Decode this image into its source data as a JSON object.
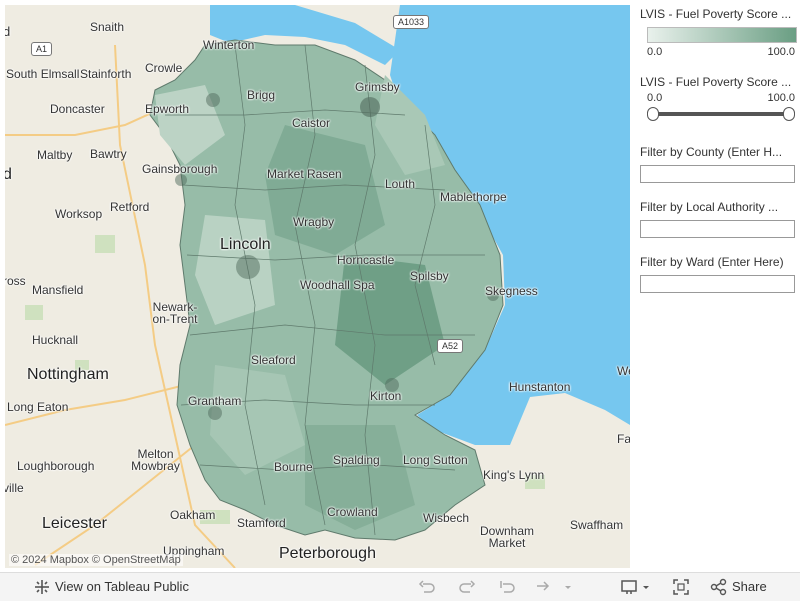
{
  "map": {
    "towns": [
      {
        "id": "snaith",
        "name": "Snaith"
      },
      {
        "id": "crowle",
        "name": "Crowle"
      },
      {
        "id": "winterton",
        "name": "Winterton"
      },
      {
        "id": "grimsby",
        "name": "Grimsby"
      },
      {
        "id": "south-elmsall",
        "name": "South Elmsall"
      },
      {
        "id": "stainforth",
        "name": "Stainforth"
      },
      {
        "id": "epworth",
        "name": "Epworth"
      },
      {
        "id": "brigg",
        "name": "Brigg"
      },
      {
        "id": "doncaster",
        "name": "Doncaster"
      },
      {
        "id": "caistor",
        "name": "Caistor"
      },
      {
        "id": "maltby",
        "name": "Maltby"
      },
      {
        "id": "bawtry",
        "name": "Bawtry"
      },
      {
        "id": "gainsborough",
        "name": "Gainsborough"
      },
      {
        "id": "market-rasen",
        "name": "Market Rasen"
      },
      {
        "id": "louth",
        "name": "Louth"
      },
      {
        "id": "mablethorpe",
        "name": "Mablethorpe"
      },
      {
        "id": "worksop",
        "name": "Worksop"
      },
      {
        "id": "retford",
        "name": "Retford"
      },
      {
        "id": "wragby",
        "name": "Wragby"
      },
      {
        "id": "lincoln",
        "name": "Lincoln"
      },
      {
        "id": "horncastle",
        "name": "Horncastle"
      },
      {
        "id": "spilsby",
        "name": "Spilsby"
      },
      {
        "id": "mansfield",
        "name": "Mansfield"
      },
      {
        "id": "woodhall-spa",
        "name": "Woodhall Spa"
      },
      {
        "id": "skegness",
        "name": "Skegness"
      },
      {
        "id": "newark",
        "name": "Newark-on-Trent"
      },
      {
        "id": "hucknall",
        "name": "Hucknall"
      },
      {
        "id": "sleaford",
        "name": "Sleaford"
      },
      {
        "id": "nottingham",
        "name": "Nottingham"
      },
      {
        "id": "hunstanton",
        "name": "Hunstanton"
      },
      {
        "id": "long-eaton",
        "name": "Long Eaton"
      },
      {
        "id": "grantham",
        "name": "Grantham"
      },
      {
        "id": "kirton",
        "name": "Kirton"
      },
      {
        "id": "melton",
        "name": "Melton Mowbray"
      },
      {
        "id": "loughborough",
        "name": "Loughborough"
      },
      {
        "id": "spalding",
        "name": "Spalding"
      },
      {
        "id": "long-sutton",
        "name": "Long Sutton"
      },
      {
        "id": "kings-lynn",
        "name": "King's Lynn"
      },
      {
        "id": "bourne",
        "name": "Bourne"
      },
      {
        "id": "oakham",
        "name": "Oakham"
      },
      {
        "id": "crowland",
        "name": "Crowland"
      },
      {
        "id": "wisbech",
        "name": "Wisbech"
      },
      {
        "id": "downham",
        "name": "Downham Market"
      },
      {
        "id": "swaffham",
        "name": "Swaffham"
      },
      {
        "id": "leicester",
        "name": "Leicester"
      },
      {
        "id": "stamford",
        "name": "Stamford"
      },
      {
        "id": "uppingham",
        "name": "Uppingham"
      },
      {
        "id": "peterborough",
        "name": "Peterborough"
      }
    ],
    "edge_fragments": {
      "d_top": "d",
      "d_mid": "d",
      "ross": "ross",
      "ville": "ville",
      "we": "We",
      "fa": "Fa"
    },
    "roads": {
      "a1033": "A1033",
      "a1": "A1",
      "a52": "A52"
    },
    "attribution": "© 2024 Mapbox  © OpenStreetMap",
    "sea_color": "#76c7ef",
    "land_color": "#efece2",
    "choropleth_low": "#e9f1ec",
    "choropleth_high": "#6a9e83"
  },
  "panel": {
    "legend_title": "LVIS - Fuel Poverty Score ...",
    "legend_min": "0.0",
    "legend_max": "100.0",
    "slider_title": "LVIS - Fuel Poverty Score ...",
    "slider_min": "0.0",
    "slider_max": "100.0",
    "slider_low": 0.0,
    "slider_high": 100.0,
    "filter_county": "Filter by County (Enter H...",
    "filter_la": "Filter by Local Authority ...",
    "filter_ward": "Filter by Ward (Enter Here)",
    "filter_county_value": "",
    "filter_la_value": "",
    "filter_ward_value": ""
  },
  "toolbar": {
    "view_label": "View on Tableau Public",
    "share_label": "Share",
    "icons": [
      "tableau-icon",
      "undo-icon",
      "redo-icon",
      "revert-icon",
      "refresh-icon",
      "download-icon",
      "fullscreen-icon",
      "share-icon"
    ]
  }
}
